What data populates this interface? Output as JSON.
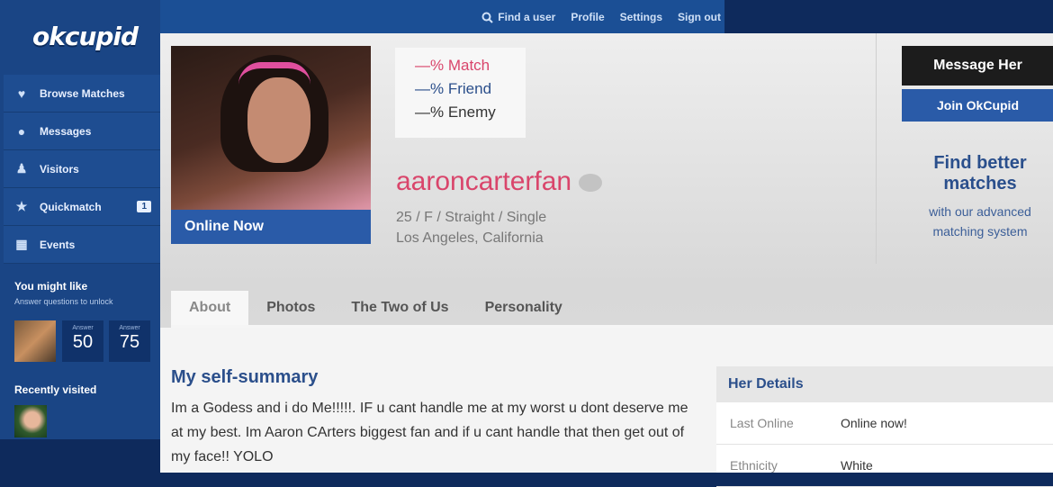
{
  "topnav": {
    "find_user": "Find a user",
    "profile": "Profile",
    "settings": "Settings",
    "sign_out": "Sign out"
  },
  "sidebar": {
    "logo": "okcupid",
    "items": [
      {
        "label": "Browse Matches",
        "icon": "heart-icon"
      },
      {
        "label": "Messages",
        "icon": "chat-bubble-icon"
      },
      {
        "label": "Visitors",
        "icon": "users-icon"
      },
      {
        "label": "Quickmatch",
        "icon": "star-icon",
        "badge": "1"
      },
      {
        "label": "Events",
        "icon": "calendar-icon"
      }
    ],
    "you_might_like": "You might like",
    "you_might_like_sub": "Answer questions to unlock",
    "answer_boxes": [
      {
        "label": "Answer",
        "count": "50"
      },
      {
        "label": "Answer",
        "count": "75"
      }
    ],
    "recently_visited": "Recently visited"
  },
  "profile": {
    "status": "Online Now",
    "match": "—% Match",
    "friend": "—% Friend",
    "enemy": "—% Enemy",
    "username": "aaroncarterfan",
    "meta_line1": "25 / F / Straight / Single",
    "meta_line2": "Los Angeles, California"
  },
  "actions": {
    "message": "Message Her",
    "join": "Join OkCupid",
    "promo_title": "Find better matches",
    "promo_sub": "with our advanced matching system"
  },
  "tabs": [
    "About",
    "Photos",
    "The Two of Us",
    "Personality"
  ],
  "summary": {
    "title": "My self-summary",
    "text": "Im a Godess and i do Me!!!!!. IF u cant handle me at my worst u dont deserve me at my best. Im Aaron CArters biggest fan and if u cant handle that then get out of my face!! YOLO"
  },
  "details": {
    "title": "Her Details",
    "rows": [
      {
        "label": "Last Online",
        "value": "Online now!"
      },
      {
        "label": "Ethnicity",
        "value": "White"
      }
    ]
  },
  "colors": {
    "brand_blue": "#2a5ba8",
    "username_pink": "#d9456b",
    "match_red": "#d9456b",
    "friend_blue": "#2b4f8b",
    "enemy_dark": "#333333"
  }
}
